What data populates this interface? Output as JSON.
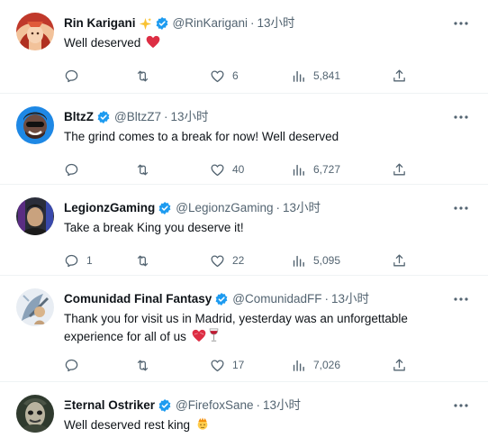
{
  "tweets": [
    {
      "name": "Rin Karigani",
      "name_emoji": "sparkles-emoji",
      "handle": "@RinKarigani",
      "dot": "·",
      "time": "13小时",
      "text": "Well deserved",
      "text_emoji": "red-heart-emoji",
      "replies": "",
      "retweets": "",
      "likes": "6",
      "views": "5,841"
    },
    {
      "name": "BltzZ",
      "handle": "@BltzZ7",
      "dot": "·",
      "time": "13小时",
      "text": "The grind comes to a break for now! Well deserved",
      "replies": "",
      "retweets": "",
      "likes": "40",
      "views": "6,727"
    },
    {
      "name": "LegionzGaming",
      "handle": "@LegionzGaming",
      "dot": "·",
      "time": "13小时",
      "text": "Take a break King you deserve it!",
      "replies": "1",
      "retweets": "",
      "likes": "22",
      "views": "5,095"
    },
    {
      "name": "Comunidad Final Fantasy",
      "handle": "@ComunidadFF",
      "dot": "·",
      "time": "13小时",
      "text": "Thank you for visit us in Madrid, yesterday was an unforgettable experience for all of us",
      "text_emoji": "heart-and-wine-emoji",
      "replies": "",
      "retweets": "",
      "likes": "17",
      "views": "7,026"
    },
    {
      "name": "Ξternal Ostriker",
      "handle": "@FirefoxSane",
      "dot": "·",
      "time": "13小时",
      "text": "Well deserved rest king",
      "text_emoji": "prince-emoji"
    }
  ],
  "colors": {
    "verified": "#1d9bf0",
    "muted": "#536471",
    "text": "#0f1419",
    "divider": "#eff3f4"
  }
}
